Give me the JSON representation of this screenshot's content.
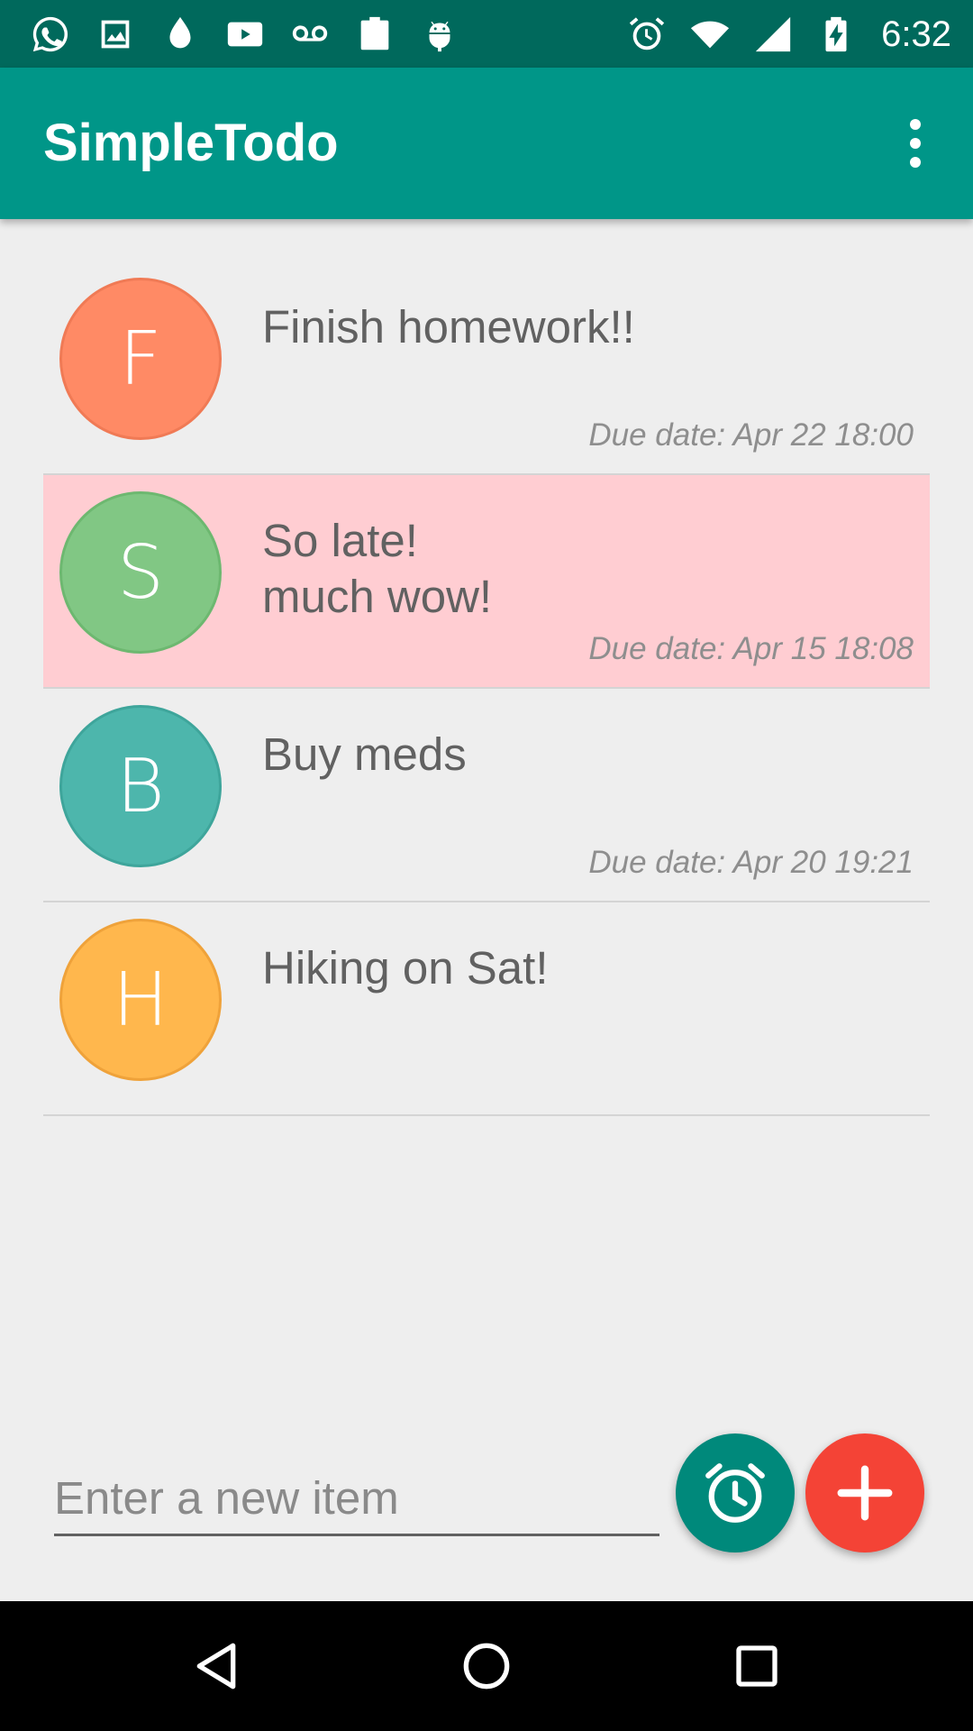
{
  "status_bar": {
    "time": "6:32",
    "left_icons": [
      "whatsapp-icon",
      "image-icon",
      "drop-icon",
      "youtube-icon",
      "voicemail-icon",
      "clipboard-check-icon",
      "android-icon"
    ],
    "right_icons": [
      "alarm-icon",
      "wifi-icon",
      "cell-signal-icon",
      "battery-charging-icon"
    ]
  },
  "app_bar": {
    "title": "SimpleTodo",
    "overflow_icon": "more-vert-icon"
  },
  "todo_items": [
    {
      "initial": "F",
      "title": "Finish homework!!",
      "due": "Due date: Apr 22 18:00",
      "avatar_color": "#ff8a65",
      "overdue": false
    },
    {
      "initial": "S",
      "title": "So late!\n              much wow!",
      "due": "Due date: Apr 15 18:08",
      "avatar_color": "#81c784",
      "overdue": true
    },
    {
      "initial": "B",
      "title": "Buy meds",
      "due": "Due date: Apr 20 19:21",
      "avatar_color": "#4db6ac",
      "overdue": false
    },
    {
      "initial": "H",
      "title": "Hiking on Sat!",
      "due": "",
      "avatar_color": "#ffb74d",
      "overdue": false
    }
  ],
  "new_item": {
    "placeholder": "Enter a new item",
    "value": ""
  },
  "buttons": {
    "alarm_icon": "alarm-icon",
    "add_icon": "add-icon"
  },
  "colors": {
    "primary": "#009688",
    "primary_dark": "#00695c",
    "accent": "#f44336",
    "overdue_bg": "#ffcdd2"
  },
  "nav_bar": {
    "icons": [
      "back-icon",
      "home-icon",
      "recents-icon"
    ]
  }
}
